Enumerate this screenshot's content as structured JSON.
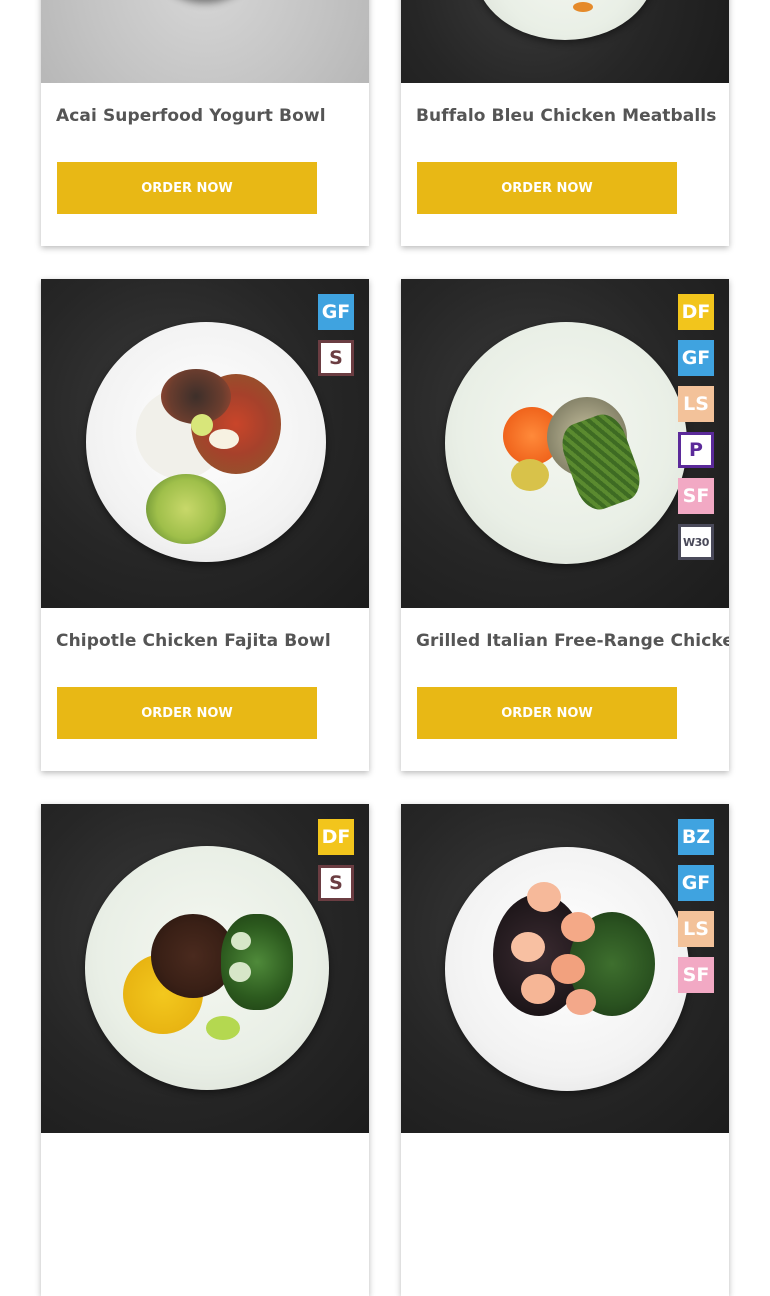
{
  "order_button_label": "ORDER NOW",
  "brand_accent": "#e8b815",
  "badge_colors": {
    "DF": "#f2c51c",
    "GF": "#3fa3e0",
    "S": "#6b3d42",
    "LS": "#f3c29a",
    "P": "#5b2a9a",
    "SF": "#f2a9c4",
    "W30": "#4a4a5a",
    "BZ": "#3fa3e0"
  },
  "cards": [
    {
      "title": "Acai Superfood Yogurt Bowl",
      "badges": []
    },
    {
      "title": "Buffalo Bleu Chicken Meatballs",
      "badges": []
    },
    {
      "title": "Chipotle Chicken Fajita Bowl",
      "badges": [
        "GF",
        "S"
      ]
    },
    {
      "title": "Grilled Italian Free-Range Chicken",
      "badges": [
        "DF",
        "GF",
        "LS",
        "P",
        "SF",
        "W30"
      ]
    },
    {
      "title": "",
      "badges": [
        "DF",
        "S"
      ]
    },
    {
      "title": "",
      "badges": [
        "BZ",
        "GF",
        "LS",
        "SF"
      ]
    }
  ]
}
